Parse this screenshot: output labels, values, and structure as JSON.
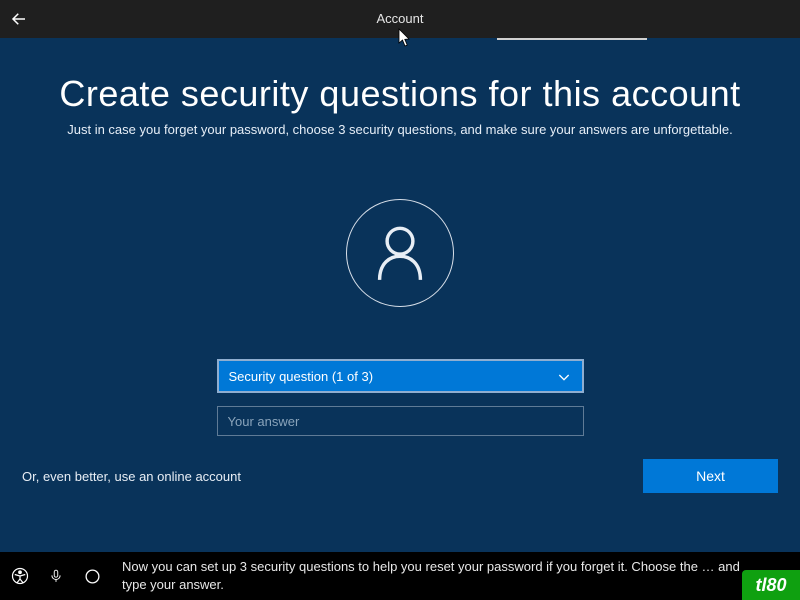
{
  "topbar": {
    "tab_label": "Account"
  },
  "page": {
    "title": "Create security questions for this account",
    "subtitle": "Just in case you forget your password, choose 3 security questions, and make sure your answers are unforgettable."
  },
  "form": {
    "dropdown_label": "Security question (1 of 3)",
    "answer_placeholder": "Your answer"
  },
  "footer": {
    "online_link": "Or, even better, use an online account",
    "next_label": "Next"
  },
  "taskbar": {
    "narrator_text": "Now you can set up 3 security questions to help you reset your password if you forget it. Choose the … and type your answer."
  },
  "watermark": {
    "text": "tl80"
  }
}
